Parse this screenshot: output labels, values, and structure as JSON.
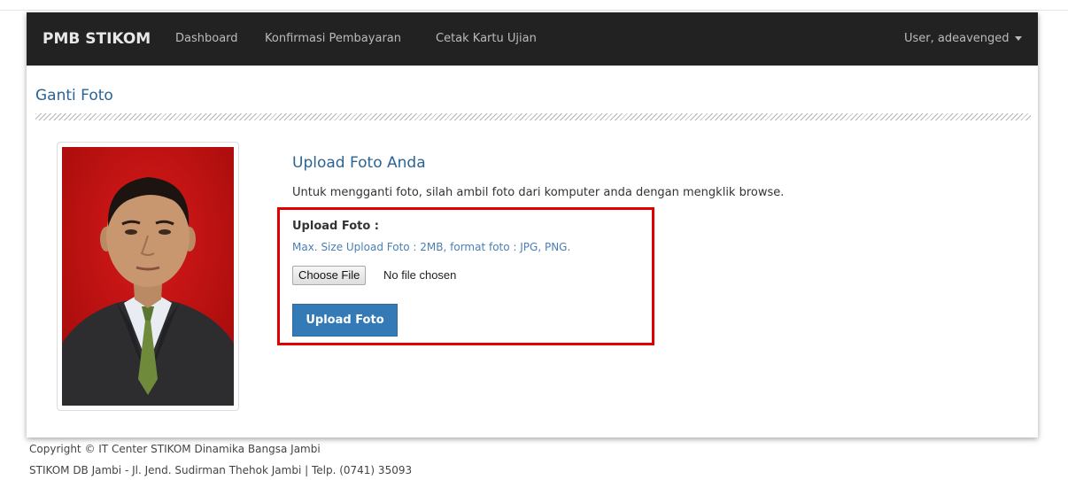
{
  "navbar": {
    "brand": "PMB STIKOM",
    "items": [
      "Dashboard",
      "Konfirmasi Pembayaran",
      "Cetak Kartu Ujian"
    ],
    "user_menu": "User, adeavenged",
    "user_menu_icon": "caret-down-icon"
  },
  "page": {
    "title": "Ganti Foto"
  },
  "upload": {
    "heading": "Upload Foto Anda",
    "instruction": "Untuk mengganti foto, silah ambil foto dari komputer anda dengan mengklik browse.",
    "label": "Upload Foto :",
    "hint": "Max. Size Upload Foto : 2MB, format foto : JPG, PNG.",
    "choose_button": "Choose File",
    "no_file_text": "No file chosen",
    "submit_button": "Upload Foto"
  },
  "footer": {
    "copyright": "Copyright © IT Center STIKOM Dinamika Bangsa Jambi",
    "address": "STIKOM DB Jambi - Jl. Jend. Sudirman Thehok Jambi | Telp. (0741) 35093"
  },
  "colors": {
    "navbar_bg": "#222222",
    "accent": "#2a6496",
    "button_primary": "#337ab7",
    "highlight": "#e00000",
    "photo_bg": "#cc1010"
  }
}
